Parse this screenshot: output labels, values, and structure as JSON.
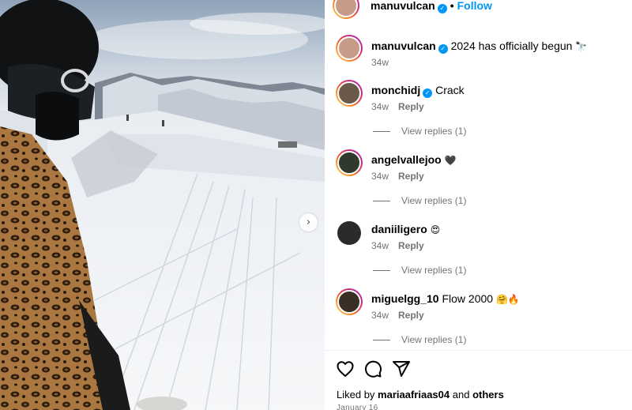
{
  "post": {
    "author": "manuvulcan",
    "verified_mark": "✓",
    "separator": "•",
    "follow_label": "Follow",
    "next_arrow": "›"
  },
  "comments": [
    {
      "user": "manuvulcan",
      "verified": true,
      "text": "2024 has officially begun",
      "emoji": "🔭",
      "time": "34w",
      "reply_label": "",
      "view_replies": ""
    },
    {
      "user": "monchidj",
      "verified": true,
      "text": "Crack",
      "emoji": "",
      "time": "34w",
      "reply_label": "Reply",
      "view_replies": "View replies (1)"
    },
    {
      "user": "angelvallejoo",
      "verified": false,
      "text": "",
      "emoji": "🖤",
      "time": "34w",
      "reply_label": "Reply",
      "view_replies": "View replies (1)"
    },
    {
      "user": "daniiligero",
      "verified": false,
      "text": "",
      "emoji": "😍",
      "time": "34w",
      "reply_label": "Reply",
      "view_replies": "View replies (1)"
    },
    {
      "user": "miguelgg_10",
      "verified": false,
      "text": "Flow 2000",
      "emoji": "🤗🔥",
      "time": "34w",
      "reply_label": "Reply",
      "view_replies": "View replies (1)"
    }
  ],
  "footer": {
    "liked_by_prefix": "Liked by",
    "liked_by_user": "mariaafriaas04",
    "liked_by_and": "and",
    "liked_by_others": "others",
    "date": "January 16"
  },
  "icons": {
    "like": "heart-icon",
    "comment": "comment-icon",
    "share": "share-icon",
    "next": "chevron-right-icon"
  },
  "colors": {
    "link_blue": "#0095f6",
    "secondary_text": "#737373",
    "story_ring": [
      "#feda75",
      "#fa7e1e",
      "#d62976",
      "#962fbf"
    ]
  }
}
